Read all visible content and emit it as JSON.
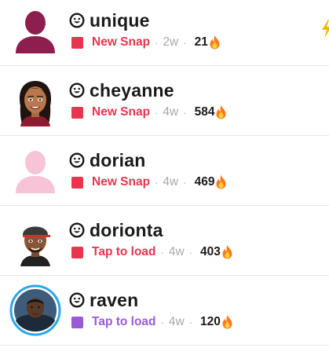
{
  "colors": {
    "new_snap": "#e8344e",
    "tap_to_load_red": "#e8344e",
    "tap_to_load_purple": "#9b59d6",
    "secondary_text": "#a9a9a9",
    "streak_fire": "#ff7a1a",
    "edge_bolt": "#f5b800"
  },
  "chats": [
    {
      "name": "unique",
      "status": "New Snap",
      "status_color": "#e8344e",
      "time": "2w",
      "streak": "21",
      "avatar": "silhouette-maroon",
      "trailing_icon": "lightning-bolt-icon"
    },
    {
      "name": "cheyanne",
      "status": "New Snap",
      "status_color": "#e8344e",
      "time": "4w",
      "streak": "584",
      "avatar": "bitmoji-female"
    },
    {
      "name": "dorian",
      "status": "New Snap",
      "status_color": "#e8344e",
      "time": "4w",
      "streak": "469",
      "avatar": "silhouette-pink"
    },
    {
      "name": "dorionta",
      "status": "Tap to load",
      "status_color": "#e8344e",
      "time": "4w",
      "streak": "403",
      "avatar": "bitmoji-male-cap"
    },
    {
      "name": "raven",
      "status": "Tap to load",
      "status_color": "#9b59d6",
      "time": "4w",
      "streak": "120",
      "avatar": "photo-story-ring"
    }
  ],
  "separator": "·"
}
